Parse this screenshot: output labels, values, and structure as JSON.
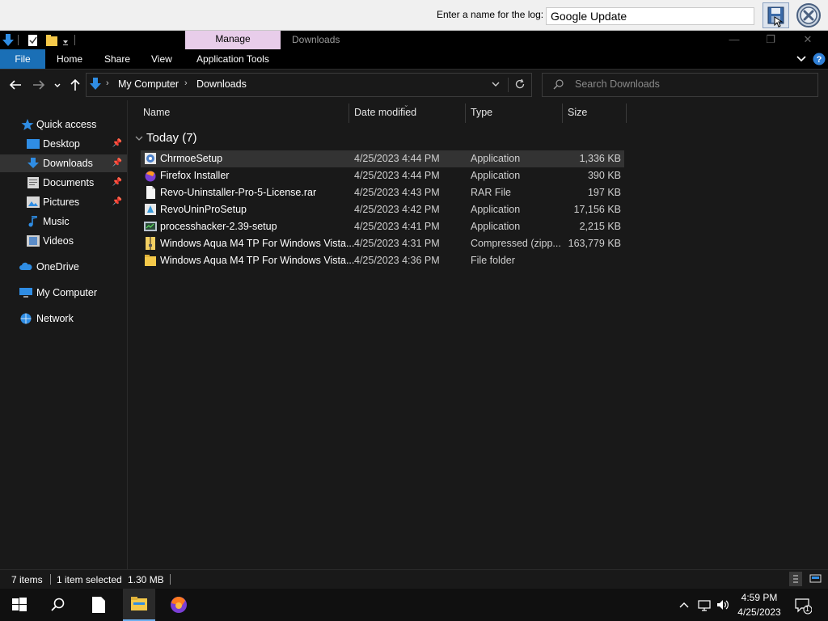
{
  "logbar": {
    "label": "Enter a name for the log:",
    "input_value": "Google Update"
  },
  "titlebar": {
    "manage_label": "Manage",
    "title": "Downloads"
  },
  "ribbon": {
    "tabs": [
      "File",
      "Home",
      "Share",
      "View",
      "Application Tools"
    ]
  },
  "address": {
    "crumbs": [
      "My Computer",
      "Downloads"
    ],
    "search_placeholder": "Search Downloads"
  },
  "nav": {
    "items": [
      {
        "label": "Quick access",
        "icon": "star-icon"
      },
      {
        "label": "Desktop",
        "icon": "desktop-icon"
      },
      {
        "label": "Downloads",
        "icon": "download-arrow-icon"
      },
      {
        "label": "Documents",
        "icon": "documents-icon"
      },
      {
        "label": "Pictures",
        "icon": "pictures-icon"
      },
      {
        "label": "Music",
        "icon": "music-note-icon"
      },
      {
        "label": "Videos",
        "icon": "videos-icon"
      },
      {
        "label": "OneDrive",
        "icon": "cloud-icon"
      },
      {
        "label": "My Computer",
        "icon": "computer-icon"
      },
      {
        "label": "Network",
        "icon": "network-icon"
      }
    ]
  },
  "columns": [
    "Name",
    "Date modified",
    "Type",
    "Size"
  ],
  "group": {
    "label": "Today (7)"
  },
  "files": [
    {
      "name": "ChrmoeSetup",
      "date": "4/25/2023 4:44 PM",
      "type": "Application",
      "size": "1,336 KB",
      "icon": "chrome-setup-icon"
    },
    {
      "name": "Firefox Installer",
      "date": "4/25/2023 4:44 PM",
      "type": "Application",
      "size": "390 KB",
      "icon": "firefox-installer-icon"
    },
    {
      "name": "Revo-Uninstaller-Pro-5-License.rar",
      "date": "4/25/2023 4:43 PM",
      "type": "RAR File",
      "size": "197 KB",
      "icon": "blank-file-icon"
    },
    {
      "name": "RevoUninProSetup",
      "date": "4/25/2023 4:42 PM",
      "type": "Application",
      "size": "17,156 KB",
      "icon": "revo-setup-icon"
    },
    {
      "name": "processhacker-2.39-setup",
      "date": "4/25/2023 4:41 PM",
      "type": "Application",
      "size": "2,215 KB",
      "icon": "processhacker-icon"
    },
    {
      "name": "Windows Aqua M4 TP For Windows Vista...",
      "date": "4/25/2023 4:31 PM",
      "type": "Compressed (zipp...",
      "size": "163,779 KB",
      "icon": "zip-folder-icon"
    },
    {
      "name": "Windows Aqua M4 TP For Windows Vista...",
      "date": "4/25/2023 4:36 PM",
      "type": "File folder",
      "size": "",
      "icon": "folder-icon"
    }
  ],
  "status": {
    "items": "7 items",
    "selected": "1 item selected",
    "size": "1.30 MB"
  },
  "taskbar": {
    "time": "4:59 PM",
    "date": "4/25/2023",
    "notification_count": "1"
  },
  "colors": {
    "accent": "#1a6fb6",
    "manage_tab": "#e8cdea",
    "background": "#191919"
  }
}
